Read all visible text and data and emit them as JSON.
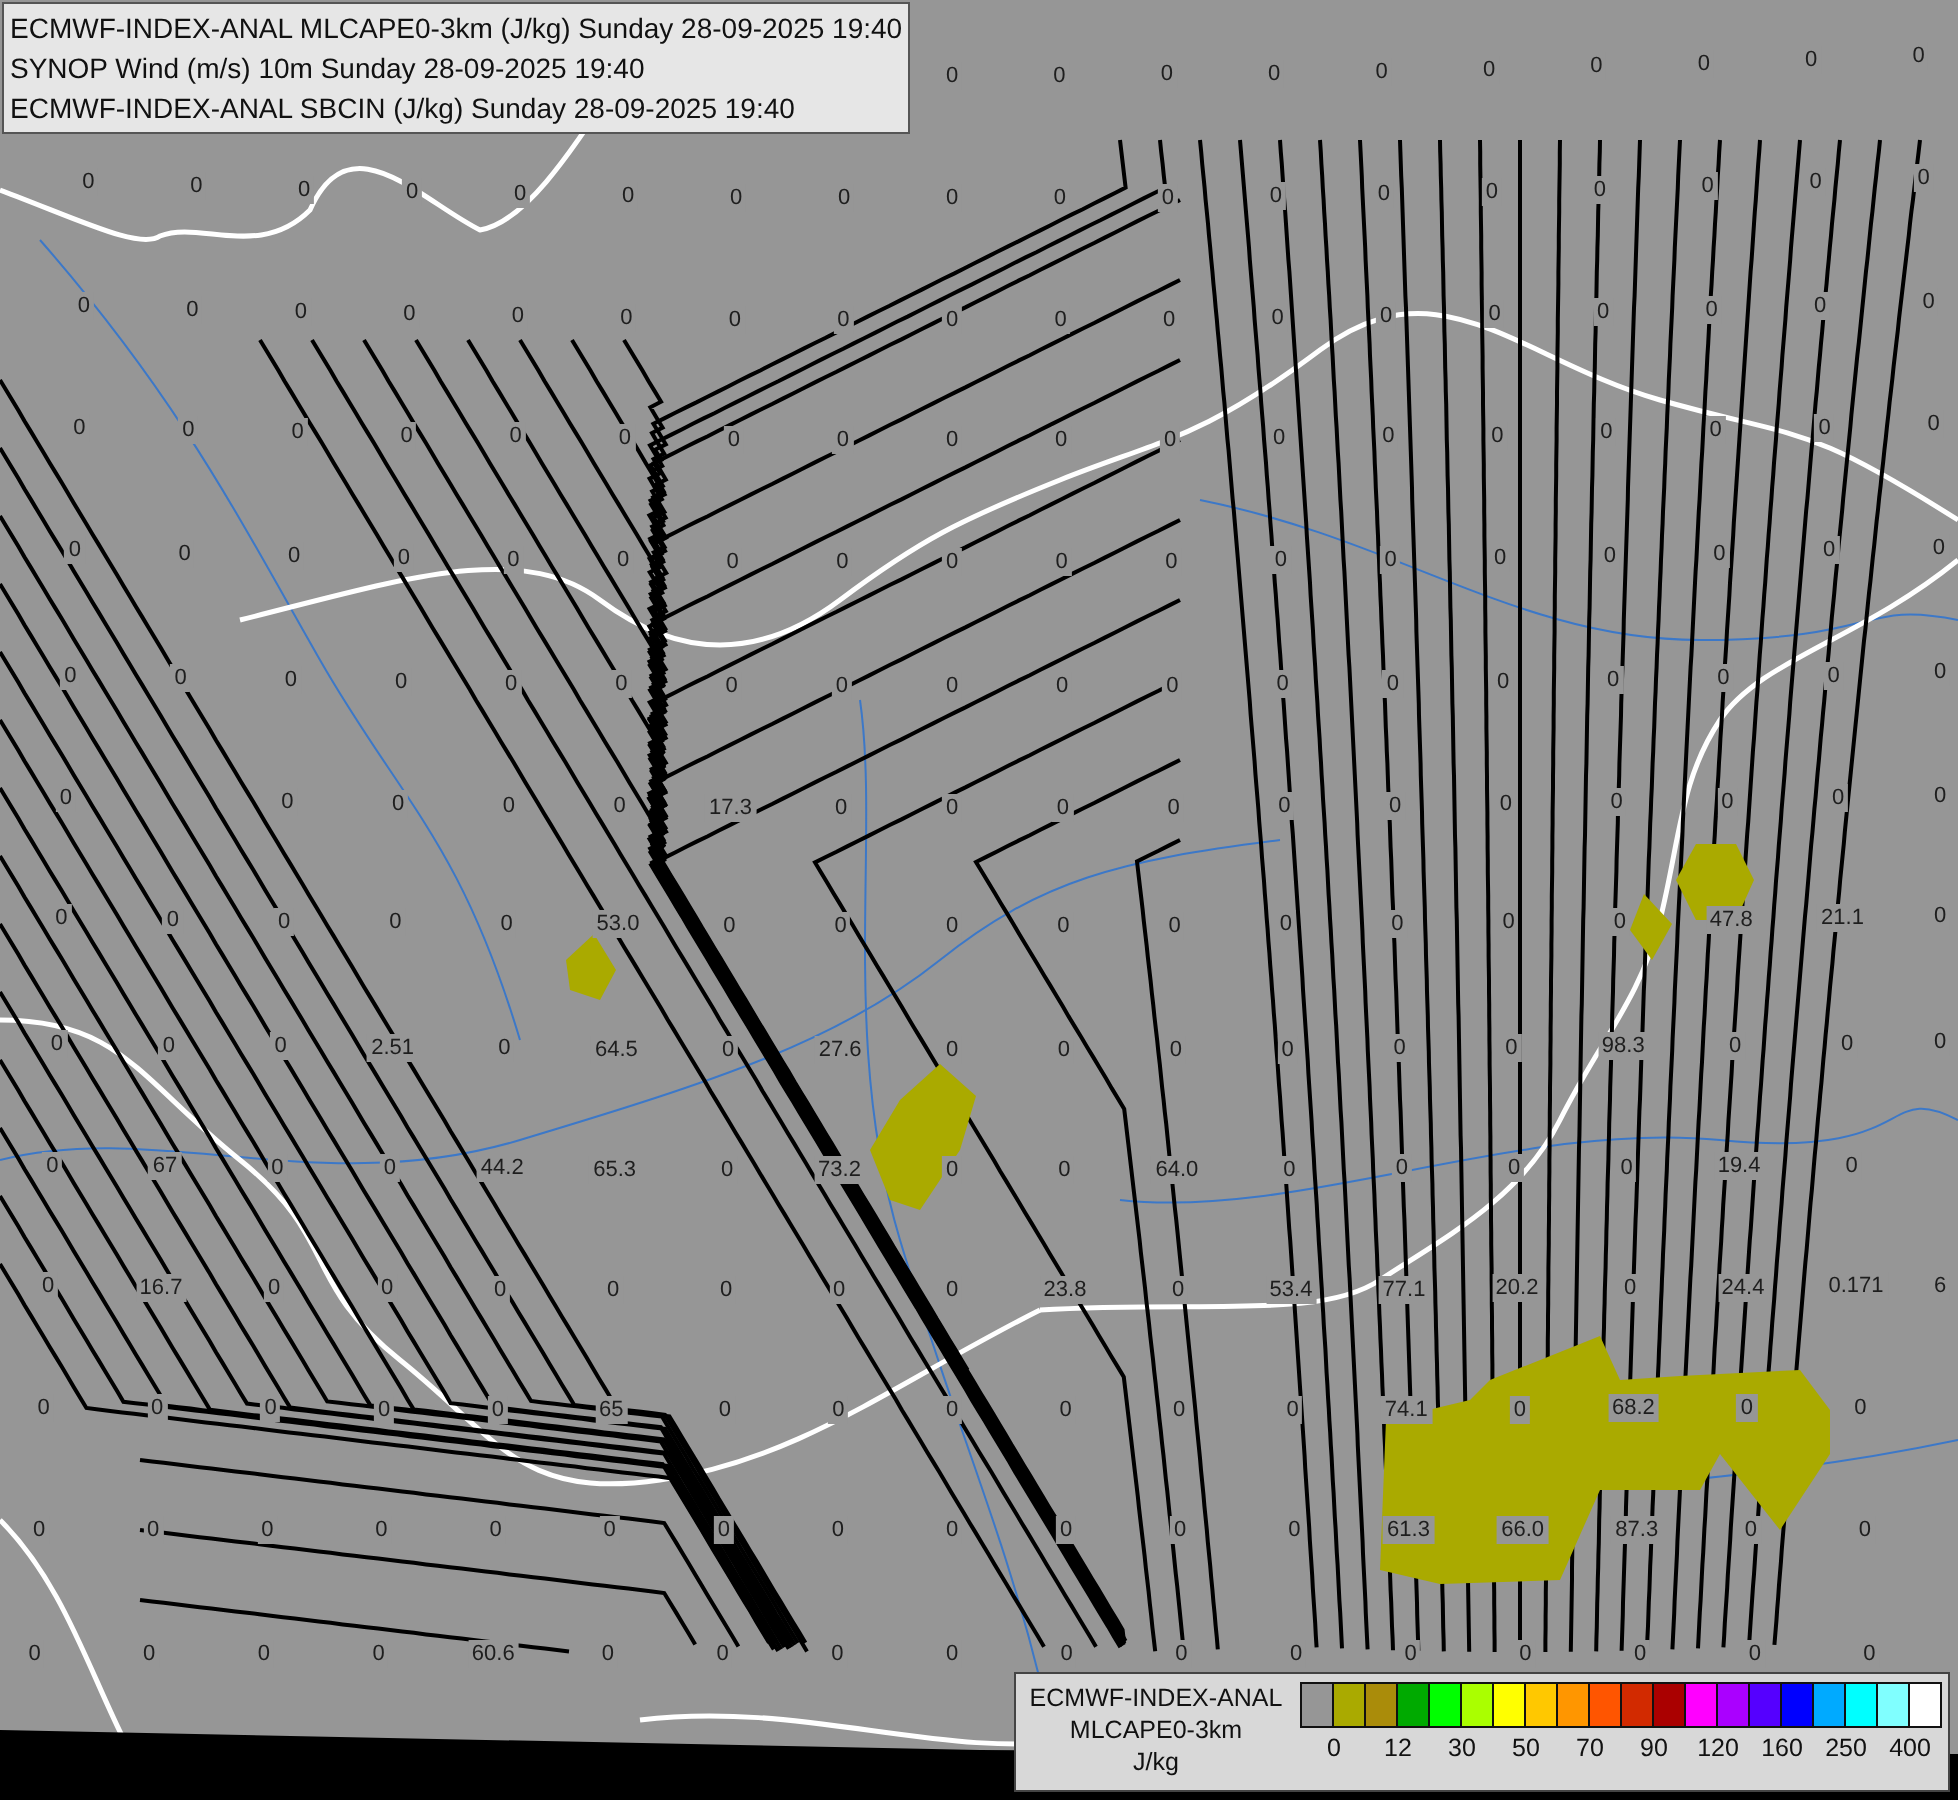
{
  "title_box": {
    "lines": [
      "ECMWF-INDEX-ANAL MLCAPE0-3km (J/kg) Sunday 28-09-2025 19:40",
      "SYNOP Wind (m/s) 10m Sunday 28-09-2025 19:40",
      "ECMWF-INDEX-ANAL SBCIN (J/kg) Sunday 28-09-2025 19:40"
    ]
  },
  "map": {
    "label_rows": [
      [
        null,
        null,
        null,
        null,
        null,
        null,
        null,
        null,
        "0",
        "0",
        "0",
        "0",
        "0",
        "0",
        "0",
        "0",
        "0",
        "0"
      ],
      [
        "0",
        "0",
        "0",
        "0",
        "0",
        "0",
        "0",
        "0",
        "0",
        "0",
        "0",
        "0",
        "0",
        "0",
        "0",
        "0",
        "0",
        "0"
      ],
      [
        "0",
        "0",
        "0",
        "0",
        "0",
        "0",
        "0",
        "0",
        "0",
        "0",
        "0",
        "0",
        "0",
        "0",
        "0",
        "0",
        "0",
        "0"
      ],
      [
        "0",
        "0",
        "0",
        "0",
        "0",
        "0",
        "0",
        "0",
        "0",
        "0",
        "0",
        "0",
        "0",
        "0",
        "0",
        "0",
        "0",
        "0"
      ],
      [
        "0",
        "0",
        "0",
        "0",
        "0",
        "0",
        "0",
        "0",
        "0",
        "0",
        "0",
        "0",
        "0",
        "0",
        "0",
        "0",
        "0",
        "0"
      ],
      [
        "0",
        "0",
        "0",
        "0",
        "0",
        "0",
        "0",
        "0",
        "0",
        "0",
        "0",
        "0",
        "0",
        "0",
        "0",
        "0",
        "0",
        "0"
      ],
      [
        "0",
        null,
        "0",
        "0",
        "0",
        "0",
        "17.3",
        "0",
        "0",
        "0",
        "0",
        "0",
        "0",
        "0",
        "0",
        "0",
        "0",
        "0"
      ],
      [
        "0",
        "0",
        "0",
        "0",
        "0",
        "53.0",
        "0",
        "0",
        "0",
        "0",
        "0",
        "0",
        "0",
        "0",
        "0",
        "47.8",
        "21.1",
        "0"
      ],
      [
        "0",
        "0",
        "0",
        "2.51",
        "0",
        "64.5",
        "0",
        "27.6",
        "0",
        "0",
        "0",
        "0",
        "0",
        "0",
        "98.3",
        "0",
        "0",
        "0"
      ],
      [
        "0",
        "67",
        "0",
        "0",
        "44.2",
        "65.3",
        "0",
        "73.2",
        "0",
        "0",
        "64.0",
        "0",
        "0",
        "0",
        "0",
        "19.4",
        "0",
        null
      ],
      [
        "0",
        "16.7",
        "0",
        "0",
        "0",
        "0",
        "0",
        "0",
        "0",
        "23.8",
        "0",
        "53.4",
        "77.1",
        "20.2",
        "0",
        "24.4",
        "0.171",
        "6"
      ],
      [
        "0",
        "0",
        "0",
        "0",
        "0",
        "65",
        "0",
        "0",
        "0",
        "0",
        "0",
        "0",
        "74.1",
        "0",
        "68.2",
        "0",
        "0",
        null
      ],
      [
        "0",
        "0",
        "0",
        "0",
        "0",
        "0",
        "0",
        "0",
        "0",
        "0",
        "0",
        "0",
        "61.3",
        "66.0",
        "87.3",
        "0",
        "0",
        null
      ],
      [
        "0",
        "0",
        "0",
        "0",
        "60.6",
        "0",
        "0",
        "0",
        "0",
        "0",
        "0",
        "0",
        "0",
        "0",
        "0",
        "0",
        "0",
        null
      ]
    ]
  },
  "legend": {
    "title_lines": [
      "ECMWF-INDEX-ANAL",
      "MLCAPE0-3km"
    ],
    "unit": "J/kg",
    "swatches": [
      {
        "color": "#969696"
      },
      {
        "color": "#aaaa00"
      },
      {
        "color": "#aa8c0a"
      },
      {
        "color": "#00aa00"
      },
      {
        "color": "#00ff00"
      },
      {
        "color": "#aaff00"
      },
      {
        "color": "#ffff00"
      },
      {
        "color": "#ffc800"
      },
      {
        "color": "#ff9600"
      },
      {
        "color": "#ff5500"
      },
      {
        "color": "#d22a00"
      },
      {
        "color": "#aa0000"
      },
      {
        "color": "#ff00ff"
      },
      {
        "color": "#aa00ff"
      },
      {
        "color": "#5500ff"
      },
      {
        "color": "#0000ff"
      },
      {
        "color": "#00aaff"
      },
      {
        "color": "#00ffff"
      },
      {
        "color": "#80ffff"
      },
      {
        "color": "#ffffff"
      }
    ],
    "ticks": [
      "0",
      "12",
      "30",
      "50",
      "70",
      "90",
      "120",
      "160",
      "250",
      "400"
    ]
  }
}
